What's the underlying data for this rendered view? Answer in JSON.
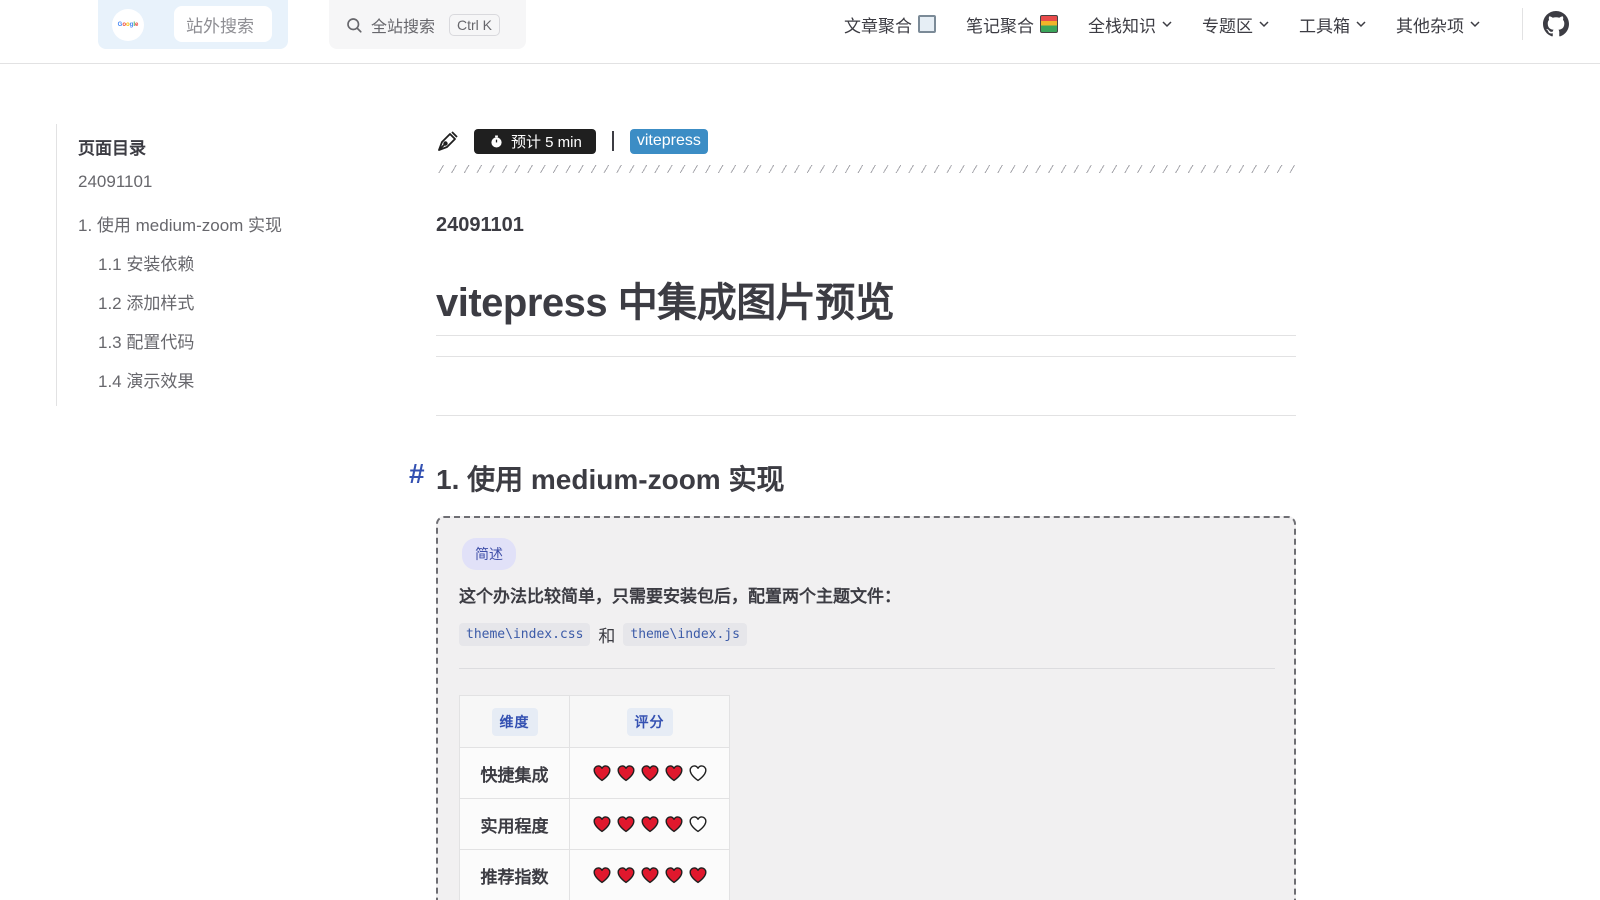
{
  "topnav": {
    "google_logo_text": "Google",
    "external_search_placeholder": "站外搜索",
    "site_search_label": "全站搜索",
    "site_search_shortcut": "Ctrl K",
    "items": [
      {
        "label": "文章聚合",
        "icon": "newspaper-icon",
        "dropdown": false
      },
      {
        "label": "笔记聚合",
        "icon": "books-icon",
        "dropdown": false
      },
      {
        "label": "全栈知识",
        "dropdown": true
      },
      {
        "label": "专题区",
        "dropdown": true
      },
      {
        "label": "工具箱",
        "dropdown": true
      },
      {
        "label": "其他杂项",
        "dropdown": true
      }
    ],
    "github_icon": "github-icon"
  },
  "toc": {
    "title": "页面目录",
    "items": [
      {
        "label": "24091101",
        "level": 1
      },
      {
        "label": "1. 使用 medium-zoom 实现",
        "level": 1
      },
      {
        "label": "1.1 安装依赖",
        "level": 2
      },
      {
        "label": "1.2 添加样式",
        "level": 2
      },
      {
        "label": "1.3 配置代码",
        "level": 2
      },
      {
        "label": "1.4 演示效果",
        "level": 2
      }
    ]
  },
  "article": {
    "reading_time": "预计 5 min",
    "tag": "vitepress",
    "date_heading": "24091101",
    "title": "vitepress 中集成图片预览",
    "section_anchor": "#",
    "section_title": "1. 使用 medium-zoom 实现",
    "callout": {
      "pill": "简述",
      "text": "这个办法比较简单，只需要安装包后，配置两个主题文件：",
      "code_1": "theme\\index.css",
      "conjunction": "和",
      "code_2": "theme\\index.js"
    },
    "rating_table": {
      "headers": [
        "维度",
        "评分"
      ],
      "rows": [
        {
          "label": "快捷集成",
          "score": 4,
          "max": 5
        },
        {
          "label": "实用程度",
          "score": 4,
          "max": 5
        },
        {
          "label": "推荐指数",
          "score": 5,
          "max": 5
        }
      ]
    }
  },
  "colors": {
    "accent": "#3451b2",
    "tag_bg": "#3c8dc5",
    "heart_red": "#e0182d",
    "badge_bg": "#1f1f1f"
  }
}
